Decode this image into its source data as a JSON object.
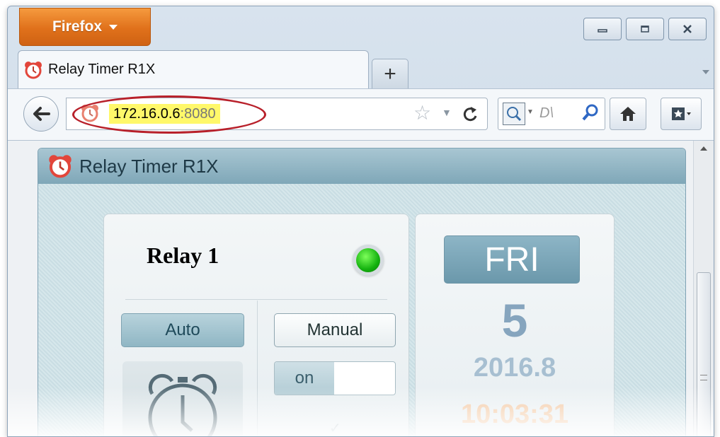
{
  "browser": {
    "menu_button": "Firefox",
    "tab_title": "Relay Timer R1X",
    "new_tab_symbol": "+",
    "url_host": "172.16.0.6",
    "url_port": ":8080",
    "search_placeholder": "D\\"
  },
  "app": {
    "title": "Relay Timer R1X",
    "relay": {
      "name": "Relay 1",
      "status_led_color": "#1cc41a",
      "auto_label": "Auto",
      "manual_label": "Manual",
      "toggle_label": "on"
    },
    "datetime": {
      "day_of_week": "FRI",
      "day": "5",
      "year_month": "2016.8",
      "time": "10:03:31"
    }
  },
  "colors": {
    "firefox_orange": "#e0711b",
    "highlight_oval": "#b8202a",
    "url_highlight": "#fff86a"
  }
}
